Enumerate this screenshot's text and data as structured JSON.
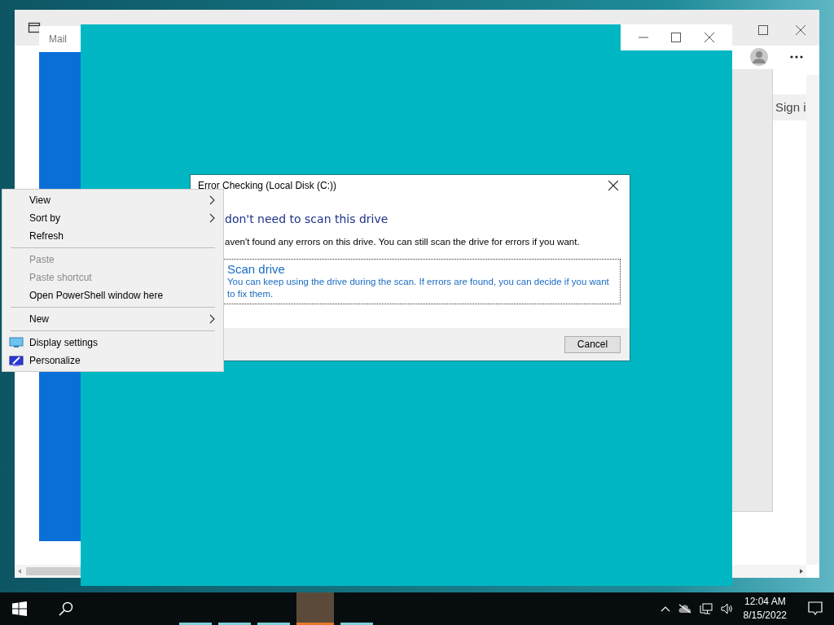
{
  "browser_window": {
    "sign_in_button": "Sign i"
  },
  "mail_window": {
    "title": "Mail"
  },
  "dialog": {
    "title": "Error Checking (Local Disk (C:))",
    "heading": "don't need to scan this drive",
    "message": "aven't found any errors on this drive. You can still scan the drive for errors if you want.",
    "option": {
      "title": "Scan drive",
      "description": "You can keep using the drive during the scan. If errors are found, you can decide if you want to fix them."
    },
    "buttons": [
      "Cancel"
    ]
  },
  "context_menu": [
    {
      "kind": "item",
      "label": "View",
      "submenu": true,
      "disabled": false
    },
    {
      "kind": "item",
      "label": "Sort by",
      "submenu": true,
      "disabled": false
    },
    {
      "kind": "item",
      "label": "Refresh",
      "submenu": false,
      "disabled": false
    },
    {
      "kind": "separator"
    },
    {
      "kind": "item",
      "label": "Paste",
      "submenu": false,
      "disabled": true
    },
    {
      "kind": "item",
      "label": "Paste shortcut",
      "submenu": false,
      "disabled": true
    },
    {
      "kind": "item",
      "label": "Open PowerShell window here",
      "submenu": false,
      "disabled": false
    },
    {
      "kind": "separator"
    },
    {
      "kind": "item",
      "label": "New",
      "submenu": true,
      "disabled": false
    },
    {
      "kind": "separator"
    },
    {
      "kind": "icon-item",
      "label": "Display settings",
      "submenu": false,
      "disabled": false
    },
    {
      "kind": "icon-item",
      "label": "Personalize",
      "submenu": false,
      "disabled": false
    }
  ],
  "taskbar": {
    "apps": [
      {
        "selected": false
      },
      {
        "selected": false
      },
      {
        "selected": false
      },
      {
        "selected": true
      },
      {
        "selected": false
      }
    ],
    "clock": {
      "time": "12:04 AM",
      "date": "8/15/2022"
    }
  }
}
